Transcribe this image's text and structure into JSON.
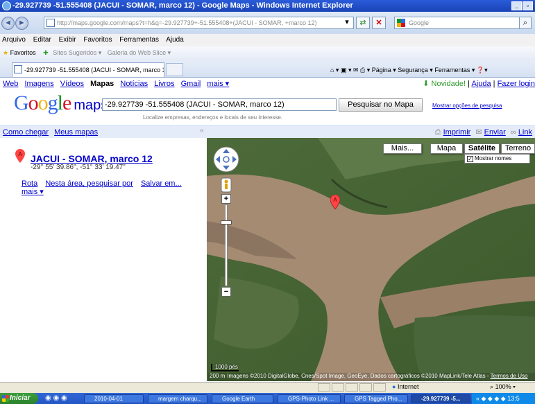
{
  "window": {
    "title": "-29.927739 -51.555408 (JACUI - SOMAR, marco 12) - Google Maps - Windows Internet Explorer",
    "btn_min": "_",
    "btn_max": "▫"
  },
  "browser": {
    "address": "http://maps.google.com/maps?t=h&q=-29.927739+-51.555408+(JACUI - SOMAR, +marco 12)",
    "search_placeholder": "Google",
    "menu": [
      "Arquivo",
      "Editar",
      "Exibir",
      "Favoritos",
      "Ferramentas",
      "Ajuda"
    ],
    "favorites": {
      "label": "Favoritos",
      "sites": "Sites Sugeridos ▾",
      "gallery": "Galeria do Web Slice ▾"
    },
    "tab_title": "-29.927739 -51.555408 (JACUI - SOMAR, marco 12) ...",
    "cmdbar": "⌂ ▾  ▣ ▾  ✉  ⎙ ▾  Página ▾  Segurança ▾  Ferramentas ▾  ❓▾"
  },
  "google": {
    "nav": [
      "Web",
      "Imagens",
      "Vídeos",
      "Mapas",
      "Notícias",
      "Livros",
      "Gmail",
      "mais ▾"
    ],
    "nav_active": "Mapas",
    "novidade": "Novidade!",
    "ajuda": "Ajuda",
    "fazer_login": "Fazer login",
    "logo": "Google",
    "logo_maps": "maps",
    "query": "-29.927739 -51.555408 (JACUI - SOMAR, marco 12)",
    "hint": "Localize empresas, endereços e locais de seu interesse.",
    "search_btn": "Pesquisar no Mapa",
    "adv": "Mostrar opções de pesquisa",
    "como_chegar": "Como chegar",
    "meus_mapas": "Meus mapas",
    "collapse": "«",
    "imprimir": "Imprimir",
    "enviar": "Enviar",
    "link": "Link"
  },
  "result": {
    "marker": "A",
    "title": "JACUI - SOMAR, marco 12",
    "coords": "-29° 55' 39.86\", -51° 33' 19.47\"",
    "rota": "Rota",
    "nesta_area": "Nesta área, pesquisar por",
    "salvar": "Salvar em...",
    "mais": "mais ▾"
  },
  "map": {
    "btn_mais": "Mais...",
    "btn_mapa": "Mapa",
    "btn_satelite": "Satélite",
    "btn_terreno": "Terreno",
    "mostrar_nomes": "Mostrar nomes",
    "mostrar_nomes_checked": true,
    "scale_label": "1000 pés",
    "scale_label2": "200 m",
    "attribution": "Imagens ©2010 DigitalGlobe, Cnes/Spot Image, GeoEye, Dados cartográficos ©2010 MapLink/Tele Atlas - ",
    "terms": "Termos de Uso",
    "marker": "A"
  },
  "statusbar": {
    "zone": "Internet",
    "zoom": "100% ▾"
  },
  "taskbar": {
    "start": "Iniciar",
    "tasks": [
      "2010-04-01",
      "margem charqu...",
      "Google Earth",
      "GPS-Photo Link ...",
      "GPS Tagged Pho...",
      "-29.927739 -5..."
    ],
    "clock": "13:5"
  },
  "colors": {
    "link": "#0000cc",
    "google_blue": "#3369e8",
    "google_red": "#d50f25",
    "google_yellow": "#eeb211",
    "google_green": "#009925",
    "strip": "#e5ecf9"
  }
}
